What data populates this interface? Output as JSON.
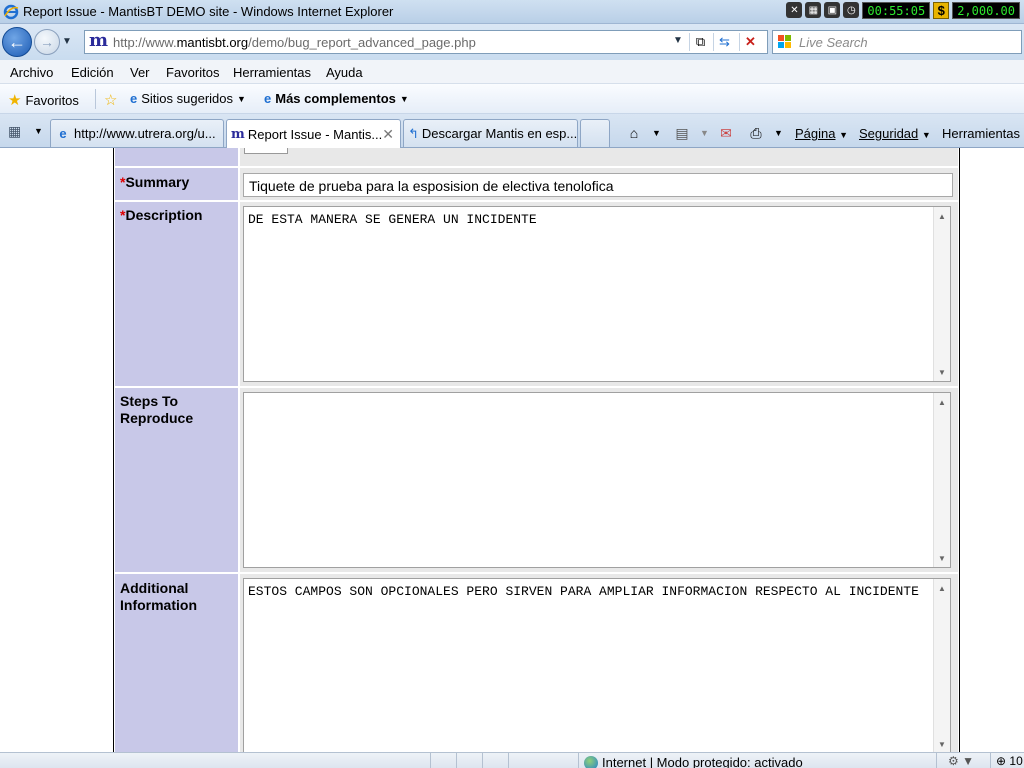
{
  "window": {
    "title": "Report Issue - MantisBT DEMO site - Windows Internet Explorer"
  },
  "tray": {
    "timer": "00:55:05",
    "dollar": "$",
    "amount": "2,000.00"
  },
  "address": {
    "url_prefix": "http://www.",
    "url_domain": "mantisbt.org",
    "url_path": "/demo/bug_report_advanced_page.php",
    "search_placeholder": "Live Search"
  },
  "menu": {
    "items": [
      "Archivo",
      "Edición",
      "Ver",
      "Favoritos",
      "Herramientas",
      "Ayuda"
    ]
  },
  "favorites_bar": {
    "favorites": "Favoritos",
    "suggested": "Sitios sugeridos",
    "addons": "Más complementos"
  },
  "tabs": [
    {
      "label": "http://www.utrera.org/u..."
    },
    {
      "label": "Report Issue - Mantis..."
    },
    {
      "label": "Descargar Mantis en esp..."
    }
  ],
  "commands": {
    "page": "Página",
    "security": "Seguridad",
    "tools": "Herramientas"
  },
  "form": {
    "summary_label": "Summary",
    "summary_value": "Tiquete de prueba para la esposision de electiva tenolofica",
    "description_label": "Description",
    "description_value": "DE ESTA MANERA SE GENERA UN INCIDENTE",
    "steps_label": "Steps To Reproduce",
    "steps_value": "",
    "additional_label": "Additional Information",
    "additional_value": "ESTOS CAMPOS SON OPCIONALES PERO SIRVEN PARA AMPLIAR INFORMACION RESPECTO AL INCIDENTE",
    "required_mark": "*"
  },
  "status": {
    "zone": "Internet | Modo protegido: activado",
    "zoom": "10"
  }
}
